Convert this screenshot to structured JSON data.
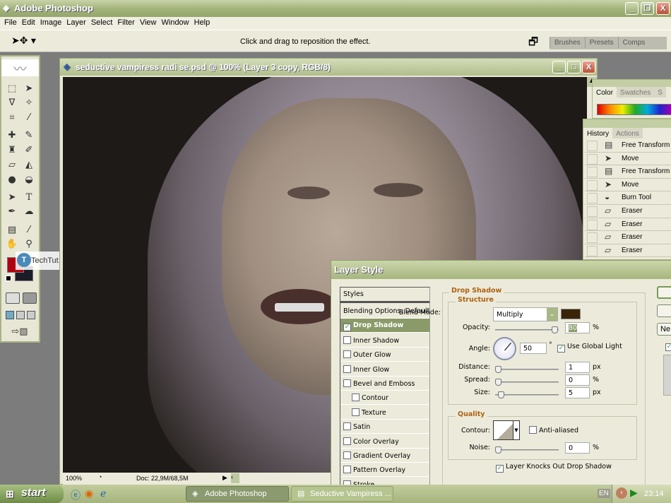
{
  "app": {
    "title": "Adobe Photoshop"
  },
  "menu": [
    "File",
    "Edit",
    "Image",
    "Layer",
    "Select",
    "Filter",
    "View",
    "Window",
    "Help"
  ],
  "options": {
    "hint": "Click and drag to reposition the effect.",
    "panel_tabs": [
      "Brushes",
      "Presets",
      "Comps"
    ]
  },
  "document": {
    "title": "seductive vampiress radi se.psd @ 100% (Layer 3 copy, RGB/8)",
    "zoom": "100%",
    "doc_size": "Doc: 22,9M/68,5M"
  },
  "watermark": "TechTut.com",
  "colors": {
    "foreground": "#b00010",
    "background": "#1c1c28",
    "shadow_color": "#3a2408",
    "accent": "#8a9a68"
  },
  "color_panel": {
    "tabs": [
      "Color",
      "Swatches",
      "S"
    ]
  },
  "history": {
    "tabs": [
      "History",
      "Actions"
    ],
    "items": [
      {
        "icon": "free-transform-icon",
        "label": "Free Transform"
      },
      {
        "icon": "move-icon",
        "label": "Move"
      },
      {
        "icon": "free-transform-icon",
        "label": "Free Transform"
      },
      {
        "icon": "move-icon",
        "label": "Move"
      },
      {
        "icon": "burn-tool-icon",
        "label": "Burn Tool"
      },
      {
        "icon": "eraser-icon",
        "label": "Eraser"
      },
      {
        "icon": "eraser-icon",
        "label": "Eraser"
      },
      {
        "icon": "eraser-icon",
        "label": "Eraser"
      },
      {
        "icon": "eraser-icon",
        "label": "Eraser"
      }
    ]
  },
  "dialog": {
    "title": "Layer Style",
    "styles": [
      {
        "label": "Styles",
        "indent": 0,
        "checkbox": false
      },
      {
        "label": "Blending Options: Default",
        "indent": 0,
        "checkbox": false
      },
      {
        "label": "Drop Shadow",
        "indent": 0,
        "checkbox": true,
        "checked": true,
        "selected": true
      },
      {
        "label": "Inner Shadow",
        "indent": 0,
        "checkbox": true,
        "checked": false
      },
      {
        "label": "Outer Glow",
        "indent": 0,
        "checkbox": true,
        "checked": false
      },
      {
        "label": "Inner Glow",
        "indent": 0,
        "checkbox": true,
        "checked": false
      },
      {
        "label": "Bevel and Emboss",
        "indent": 0,
        "checkbox": true,
        "checked": false
      },
      {
        "label": "Contour",
        "indent": 1,
        "checkbox": true,
        "checked": false
      },
      {
        "label": "Texture",
        "indent": 1,
        "checkbox": true,
        "checked": false
      },
      {
        "label": "Satin",
        "indent": 0,
        "checkbox": true,
        "checked": false
      },
      {
        "label": "Color Overlay",
        "indent": 0,
        "checkbox": true,
        "checked": false
      },
      {
        "label": "Gradient Overlay",
        "indent": 0,
        "checkbox": true,
        "checked": false
      },
      {
        "label": "Pattern Overlay",
        "indent": 0,
        "checkbox": true,
        "checked": false
      },
      {
        "label": "Stroke",
        "indent": 0,
        "checkbox": true,
        "checked": false
      }
    ],
    "section": "Drop Shadow",
    "structure": "Structure",
    "blend_mode_label": "Blend Mode:",
    "blend_mode": "Multiply",
    "opacity_label": "Opacity:",
    "opacity": "80",
    "opacity_unit": "%",
    "angle_label": "Angle:",
    "angle": "50",
    "angle_unit": "°",
    "global_light": "Use Global Light",
    "distance_label": "Distance:",
    "distance": "1",
    "distance_unit": "px",
    "spread_label": "Spread:",
    "spread": "0",
    "spread_unit": "%",
    "size_label": "Size:",
    "size": "5",
    "size_unit": "px",
    "quality": "Quality",
    "contour_label": "Contour:",
    "anti_aliased": "Anti-aliased",
    "noise_label": "Noise:",
    "noise": "0",
    "noise_unit": "%",
    "knocks_out": "Layer Knocks Out Drop Shadow",
    "new_button": "Ne"
  },
  "taskbar": {
    "start": "start",
    "tasks": [
      "Adobe Photoshop",
      "Seductive Vampiress ..."
    ],
    "lang": "EN",
    "time": "23:14"
  }
}
